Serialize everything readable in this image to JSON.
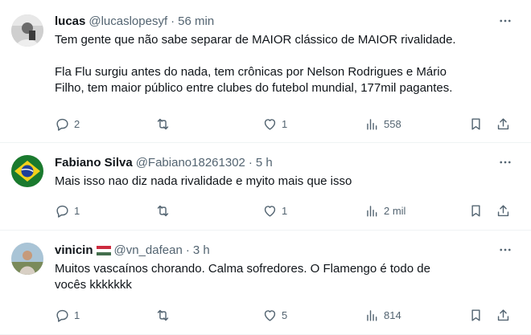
{
  "tweets": [
    {
      "name": "lucas",
      "handle": "@lucaslopesyf",
      "separator": "·",
      "time": "56 min",
      "flag": "",
      "text_lines": [
        "Tem gente que não sabe separar de MAIOR clássico de MAIOR rivalidade.",
        "",
        "Fla Flu surgiu antes do nada, tem crônicas por Nelson Rodrigues e Mário",
        "Filho, tem maior público entre clubes do futebol mundial, 177mil pagantes."
      ],
      "replies": "2",
      "retweets": "",
      "likes": "1",
      "views": "558"
    },
    {
      "name": "Fabiano Silva",
      "handle": "@Fabiano18261302",
      "separator": "·",
      "time": "5 h",
      "flag": "",
      "text_lines": [
        "Mais isso nao diz nada rivalidade e myito mais que isso"
      ],
      "replies": "1",
      "retweets": "",
      "likes": "1",
      "views": "2 mil"
    },
    {
      "name": "vinicin",
      "handle": "@vn_dafean",
      "separator": "·",
      "time": "3 h",
      "flag": "hungary-flag",
      "text_lines": [
        "Muitos vascaínos chorando. Calma sofredores. O Flamengo é todo de",
        "vocês kkkkkkk"
      ],
      "replies": "1",
      "retweets": "",
      "likes": "5",
      "views": "814"
    }
  ],
  "icons": {
    "more": "more-horizontal-icon",
    "reply": "reply-icon",
    "retweet": "retweet-icon",
    "like": "heart-icon",
    "views": "views-chart-icon",
    "bookmark": "bookmark-icon",
    "share": "share-icon"
  },
  "colors": {
    "text": "#0f1419",
    "secondary": "#536471",
    "divider": "#eff3f4"
  }
}
